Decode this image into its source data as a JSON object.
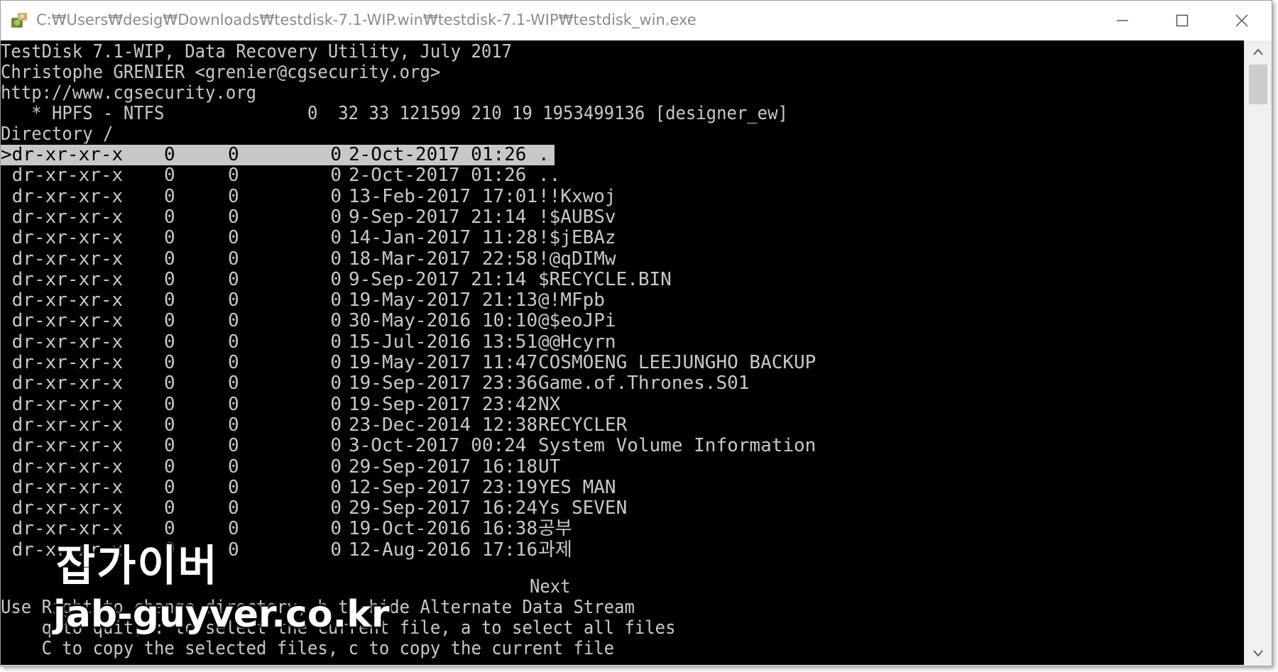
{
  "window": {
    "title": "C:₩Users₩desig₩Downloads₩testdisk-7.1-WIP.win₩testdisk-7.1-WIP₩testdisk_win.exe",
    "icon": "testdisk-app-icon",
    "minimize_icon": "minimize-icon",
    "maximize_icon": "maximize-icon",
    "close_icon": "close-icon"
  },
  "header": {
    "line1": "TestDisk 7.1-WIP, Data Recovery Utility, July 2017",
    "line2": "Christophe GRENIER <grenier@cgsecurity.org>",
    "line3": "http://www.cgsecurity.org",
    "partition": "   * HPFS - NTFS              0  32 33 121599 210 19 1953499136 [designer_ew]",
    "directory": "Directory /"
  },
  "files": [
    {
      "marker": ">",
      "perm": "dr-xr-xr-x",
      "uid": "0",
      "gid": "0",
      "size": "0",
      "date": "2-Oct-2017 01:26",
      "name": "."
    },
    {
      "marker": " ",
      "perm": "dr-xr-xr-x",
      "uid": "0",
      "gid": "0",
      "size": "0",
      "date": "2-Oct-2017 01:26",
      "name": ".."
    },
    {
      "marker": " ",
      "perm": "dr-xr-xr-x",
      "uid": "0",
      "gid": "0",
      "size": "0",
      "date": "13-Feb-2017 17:01",
      "name": "!!Kxwoj"
    },
    {
      "marker": " ",
      "perm": "dr-xr-xr-x",
      "uid": "0",
      "gid": "0",
      "size": "0",
      "date": "9-Sep-2017 21:14",
      "name": "!$AUBSv"
    },
    {
      "marker": " ",
      "perm": "dr-xr-xr-x",
      "uid": "0",
      "gid": "0",
      "size": "0",
      "date": "14-Jan-2017 11:28",
      "name": "!$jEBAz"
    },
    {
      "marker": " ",
      "perm": "dr-xr-xr-x",
      "uid": "0",
      "gid": "0",
      "size": "0",
      "date": "18-Mar-2017 22:58",
      "name": "!@qDIMw"
    },
    {
      "marker": " ",
      "perm": "dr-xr-xr-x",
      "uid": "0",
      "gid": "0",
      "size": "0",
      "date": "9-Sep-2017 21:14",
      "name": "$RECYCLE.BIN"
    },
    {
      "marker": " ",
      "perm": "dr-xr-xr-x",
      "uid": "0",
      "gid": "0",
      "size": "0",
      "date": "19-May-2017 21:13",
      "name": "@!MFpb"
    },
    {
      "marker": " ",
      "perm": "dr-xr-xr-x",
      "uid": "0",
      "gid": "0",
      "size": "0",
      "date": "30-May-2016 10:10",
      "name": "@$eoJPi"
    },
    {
      "marker": " ",
      "perm": "dr-xr-xr-x",
      "uid": "0",
      "gid": "0",
      "size": "0",
      "date": "15-Jul-2016 13:51",
      "name": "@@Hcyrn"
    },
    {
      "marker": " ",
      "perm": "dr-xr-xr-x",
      "uid": "0",
      "gid": "0",
      "size": "0",
      "date": "19-May-2017 11:47",
      "name": "COSMOENG LEEJUNGHO BACKUP"
    },
    {
      "marker": " ",
      "perm": "dr-xr-xr-x",
      "uid": "0",
      "gid": "0",
      "size": "0",
      "date": "19-Sep-2017 23:36",
      "name": "Game.of.Thrones.S01"
    },
    {
      "marker": " ",
      "perm": "dr-xr-xr-x",
      "uid": "0",
      "gid": "0",
      "size": "0",
      "date": "19-Sep-2017 23:42",
      "name": "NX"
    },
    {
      "marker": " ",
      "perm": "dr-xr-xr-x",
      "uid": "0",
      "gid": "0",
      "size": "0",
      "date": "23-Dec-2014 12:38",
      "name": "RECYCLER"
    },
    {
      "marker": " ",
      "perm": "dr-xr-xr-x",
      "uid": "0",
      "gid": "0",
      "size": "0",
      "date": "3-Oct-2017 00:24",
      "name": "System Volume Information"
    },
    {
      "marker": " ",
      "perm": "dr-xr-xr-x",
      "uid": "0",
      "gid": "0",
      "size": "0",
      "date": "29-Sep-2017 16:18",
      "name": "UT"
    },
    {
      "marker": " ",
      "perm": "dr-xr-xr-x",
      "uid": "0",
      "gid": "0",
      "size": "0",
      "date": "12-Sep-2017 23:19",
      "name": "YES MAN"
    },
    {
      "marker": " ",
      "perm": "dr-xr-xr-x",
      "uid": "0",
      "gid": "0",
      "size": "0",
      "date": "29-Sep-2017 16:24",
      "name": "Ys SEVEN"
    },
    {
      "marker": " ",
      "perm": "dr-xr-xr-x",
      "uid": "0",
      "gid": "0",
      "size": "0",
      "date": "19-Oct-2016 16:38",
      "name": "공부"
    },
    {
      "marker": " ",
      "perm": "dr-xr-xr-x",
      "uid": "0",
      "gid": "0",
      "size": "0",
      "date": "12-Aug-2016 17:16",
      "name": "과제"
    }
  ],
  "footer": {
    "next": "Next",
    "help1": "Use Right to change directory, h to hide Alternate Data Stream",
    "help2": "    q to quit, : to select the current file, a to select all files",
    "help3": "    C to copy the selected files, c to copy the current file"
  },
  "watermark": {
    "korean": "잡가이버",
    "url": "jab-guyver.co.kr"
  },
  "colors": {
    "console_bg": "#000000",
    "console_fg": "#c8c8c8",
    "selection_bg": "#c8c8c8",
    "title_text": "#8a8a8a"
  }
}
